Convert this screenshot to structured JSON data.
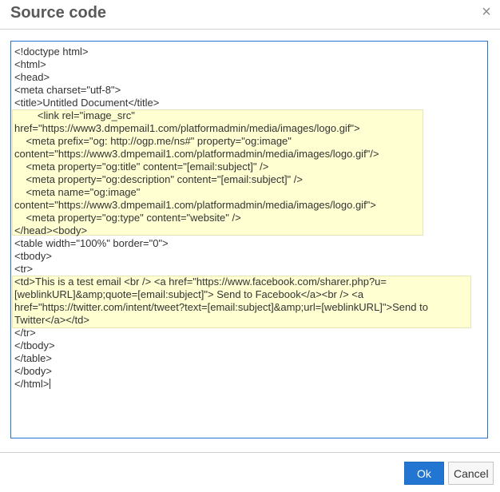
{
  "dialog": {
    "title": "Source code",
    "close_icon": "×"
  },
  "editor": {
    "lines": [
      "<!doctype html>",
      "<html>",
      "<head>",
      "<meta charset=\"utf-8\">",
      "<title>Untitled Document</title>",
      "        <link rel=\"image_src\"",
      "href=\"https://www3.dmpemail1.com/platformadmin/media/images/logo.gif\">",
      "    <meta prefix=\"og: http://ogp.me/ns#\" property=\"og:image\"",
      "content=\"https://www3.dmpemail1.com/platformadmin/media/images/logo.gif\"/>",
      "    <meta property=\"og:title\" content=\"[email:subject]\" />",
      "    <meta property=\"og:description\" content=\"[email:subject]\" />",
      "    <meta name=\"og:image\"",
      "content=\"https://www3.dmpemail1.com/platformadmin/media/images/logo.gif\">",
      "    <meta property=\"og:type\" content=\"website\" />",
      "</head><body>",
      "<table width=\"100%\" border=\"0\">",
      "<tbody>",
      "<tr>",
      "<td>This is a test email <br /> <a href=\"https://www.facebook.com/sharer.php?u=",
      "[weblinkURL]&amp;quote=[email:subject]\"> Send to Facebook</a><br /> <a",
      "href=\"https://twitter.com/intent/tweet?text=[email:subject]&amp;url=[weblinkURL]\">Send to",
      "Twitter</a></td>",
      "</tr>",
      "</tbody>",
      "</table>",
      "</body>",
      "</html>"
    ]
  },
  "footer": {
    "ok_label": "Ok",
    "cancel_label": "Cancel"
  },
  "colors": {
    "accent": "#2276d2",
    "highlight": "#ffffd2"
  }
}
